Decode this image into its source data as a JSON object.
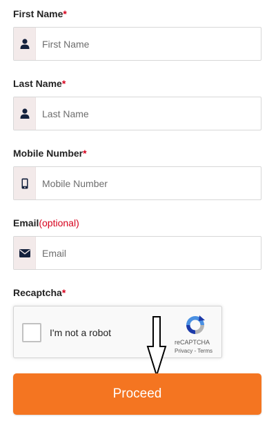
{
  "form": {
    "first_name": {
      "label": "First Name",
      "required_mark": "*",
      "placeholder": "First Name",
      "value": "",
      "icon": "user-icon"
    },
    "last_name": {
      "label": "Last Name",
      "required_mark": "*",
      "placeholder": "Last Name",
      "value": "",
      "icon": "user-icon"
    },
    "mobile": {
      "label": "Mobile Number",
      "required_mark": "*",
      "placeholder": "Mobile Number",
      "value": "",
      "icon": "mobile-phone-icon"
    },
    "email": {
      "label": "Email",
      "optional_text": "(optional)",
      "placeholder": "Email",
      "value": "",
      "icon": "envelope-icon"
    },
    "recaptcha": {
      "label": "Recaptcha",
      "required_mark": "*",
      "checkbox_text": "I'm not a robot",
      "brand": "reCAPTCHA",
      "privacy": "Privacy",
      "separator": " - ",
      "terms": "Terms",
      "checked": false
    },
    "proceed_label": "Proceed"
  },
  "colors": {
    "accent": "#f47521",
    "required": "#d6001c",
    "icon": "#14213d",
    "addon_bg": "#f3eaea"
  }
}
